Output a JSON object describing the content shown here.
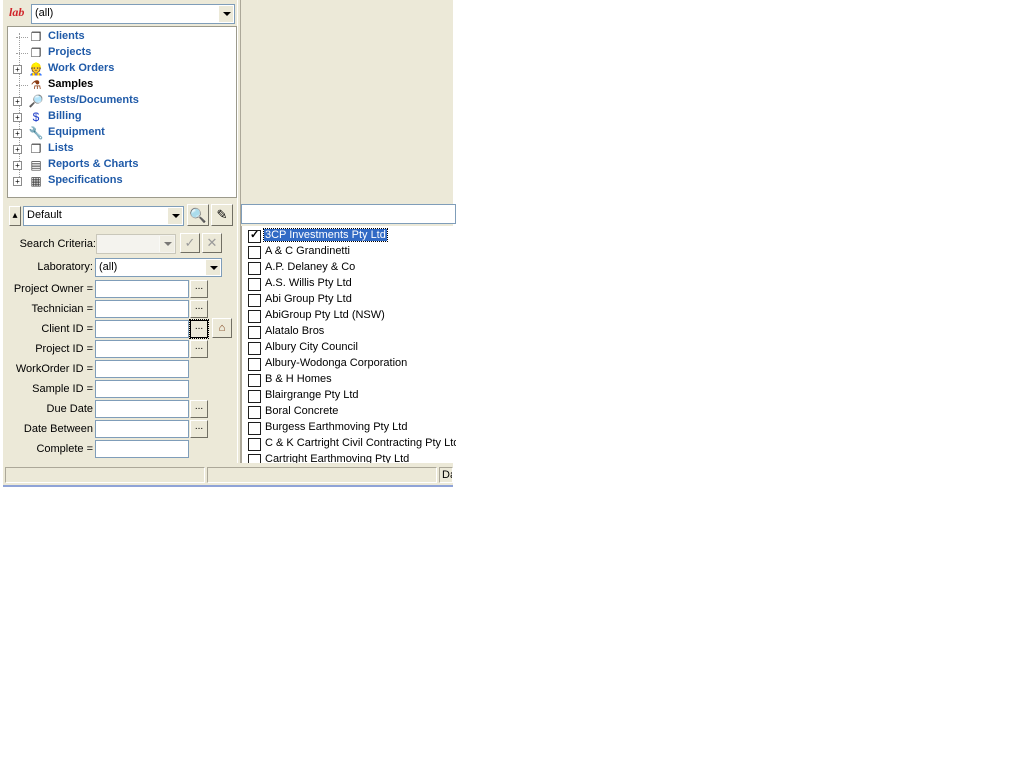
{
  "lab_selector": {
    "logo": "lab",
    "value": "(all)"
  },
  "tree": {
    "items": [
      {
        "label": "Clients",
        "icon": "document-stack-icon",
        "expandable": false
      },
      {
        "label": "Projects",
        "icon": "document-stack-icon",
        "expandable": false
      },
      {
        "label": "Work Orders",
        "icon": "worker-icon",
        "expandable": true
      },
      {
        "label": "Samples",
        "icon": "samples-icon",
        "expandable": false,
        "selected": true
      },
      {
        "label": "Tests/Documents",
        "icon": "magnifier-document-icon",
        "expandable": true
      },
      {
        "label": "Billing",
        "icon": "dollar-icon",
        "expandable": true
      },
      {
        "label": "Equipment",
        "icon": "wrench-icon",
        "expandable": true
      },
      {
        "label": "Lists",
        "icon": "document-stack-icon",
        "expandable": true
      },
      {
        "label": "Reports & Charts",
        "icon": "report-icon",
        "expandable": true
      },
      {
        "label": "Specifications",
        "icon": "specs-icon",
        "expandable": true
      }
    ]
  },
  "search": {
    "view_value": "Default",
    "criteria_label": "Search Criteria:",
    "laboratory_label": "Laboratory:",
    "laboratory_value": "(all)",
    "fields": [
      {
        "label": "Project Owner =",
        "dots": true
      },
      {
        "label": "Technician =",
        "dots": true
      },
      {
        "label": "Client ID =",
        "dots": true
      },
      {
        "label": "Project ID =",
        "dots": true
      },
      {
        "label": "WorkOrder ID =",
        "dots": false
      },
      {
        "label": "Sample ID =",
        "dots": false
      },
      {
        "label": "Due Date",
        "dots": true
      },
      {
        "label": "Date Between",
        "dots": true
      },
      {
        "label": "Complete =",
        "dots": false
      }
    ],
    "dots_label": "..."
  },
  "clients": {
    "items": [
      {
        "name": "3CP Investments Pty Ltd",
        "checked": true
      },
      {
        "name": "A & C Grandinetti",
        "checked": false
      },
      {
        "name": "A.P. Delaney & Co",
        "checked": false
      },
      {
        "name": "A.S. Willis Pty Ltd",
        "checked": false
      },
      {
        "name": "Abi Group Pty Ltd",
        "checked": false
      },
      {
        "name": "AbiGroup Pty Ltd (NSW)",
        "checked": false
      },
      {
        "name": "Alatalo Bros",
        "checked": false
      },
      {
        "name": "Albury City Council",
        "checked": false
      },
      {
        "name": "Albury-Wodonga Corporation",
        "checked": false
      },
      {
        "name": "B & H Homes",
        "checked": false
      },
      {
        "name": "Blairgrange Pty Ltd",
        "checked": false
      },
      {
        "name": "Boral Concrete",
        "checked": false
      },
      {
        "name": "Burgess Earthmoving Pty Ltd",
        "checked": false
      },
      {
        "name": "C & K Cartright Civil Contracting Pty Ltd",
        "checked": false
      },
      {
        "name": "Cartright Earthmoving Pty Ltd",
        "checked": false
      }
    ]
  },
  "status_bar": {
    "right_text": "Da"
  }
}
